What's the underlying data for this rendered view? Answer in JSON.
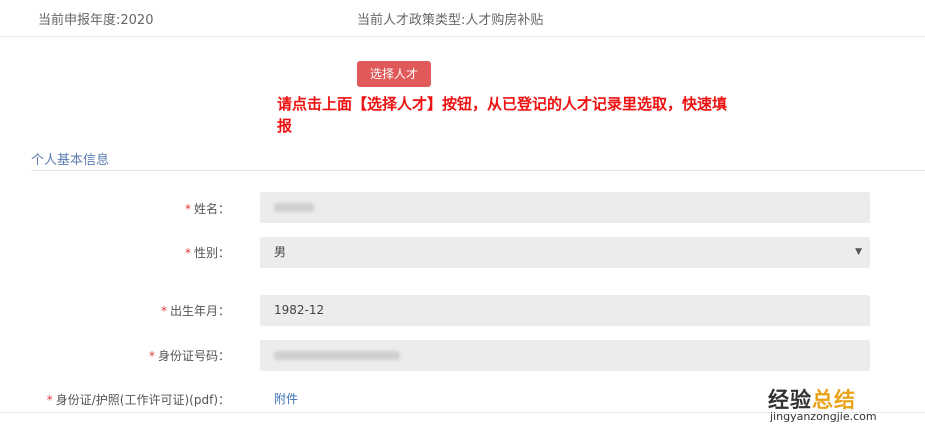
{
  "header": {
    "year": "当前申报年度:2020",
    "policy_type": "当前人才政策类型:人才购房补贴"
  },
  "actions": {
    "select_talent_label": "选择人才"
  },
  "instruction": {
    "text": "请点击上面【选择人才】按钮，从已登记的人才记录里选取，快速填报",
    "color": "#ee1111"
  },
  "section": {
    "title": "个人基本信息"
  },
  "form": {
    "required_mark": "*",
    "name": {
      "label": "姓名："
    },
    "gender": {
      "label": "性别：",
      "value": "男"
    },
    "birth": {
      "label": "出生年月：",
      "value": "1982-12"
    },
    "id_number": {
      "label": "身份证号码："
    },
    "id_doc": {
      "label": "身份证/护照(工作许可证)(pdf)：",
      "link": "附件"
    }
  },
  "watermark": {
    "text_a": "经验",
    "text_b": "总结",
    "url": "jingyanzongjie.com"
  },
  "colors": {
    "primary_button": "#e05a5a",
    "section_title": "#5b7cb0",
    "link": "#3d6fb5",
    "required": "#e03c3c",
    "field_bg": "#ececec"
  }
}
